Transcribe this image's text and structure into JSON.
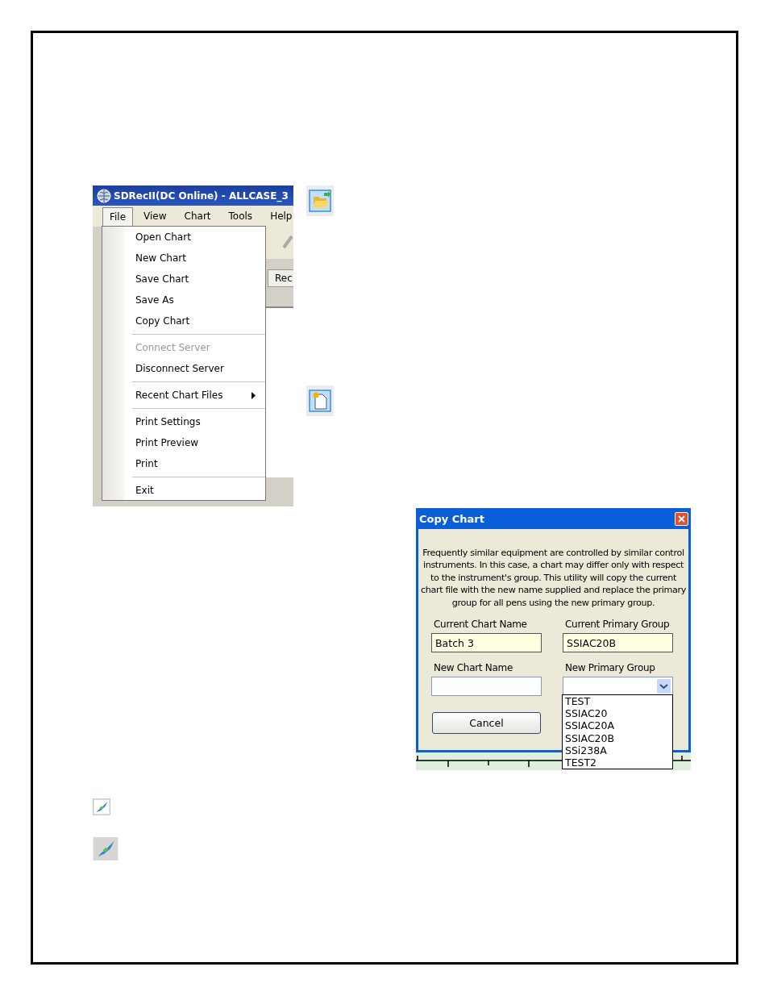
{
  "menu_window": {
    "title": "SDRecII(DC Online) - ALLCASE_3",
    "menu_bar": [
      {
        "label": "File",
        "selected": true
      },
      {
        "label": "View",
        "selected": false
      },
      {
        "label": "Chart",
        "selected": false
      },
      {
        "label": "Tools",
        "selected": false
      },
      {
        "label": "Help",
        "selected": false
      }
    ],
    "background_tab": "Rec",
    "file_menu_groups": [
      [
        {
          "label": "Open Chart",
          "disabled": false,
          "submenu": false
        },
        {
          "label": "New Chart",
          "disabled": false,
          "submenu": false
        },
        {
          "label": "Save Chart",
          "disabled": false,
          "submenu": false
        },
        {
          "label": "Save As",
          "disabled": false,
          "submenu": false
        },
        {
          "label": "Copy Chart",
          "disabled": false,
          "submenu": false
        }
      ],
      [
        {
          "label": "Connect Server",
          "disabled": true,
          "submenu": false
        },
        {
          "label": "Disconnect Server",
          "disabled": false,
          "submenu": false
        }
      ],
      [
        {
          "label": "Recent Chart Files",
          "disabled": false,
          "submenu": true
        }
      ],
      [
        {
          "label": "Print Settings",
          "disabled": false,
          "submenu": false
        },
        {
          "label": "Print Preview",
          "disabled": false,
          "submenu": false
        },
        {
          "label": "Print",
          "disabled": false,
          "submenu": false
        }
      ],
      [
        {
          "label": "Exit",
          "disabled": false,
          "submenu": false
        }
      ]
    ]
  },
  "copy_chart_dialog": {
    "title": "Copy Chart",
    "description": "Frequently similar equipment are controlled by similar control instruments.  In this case, a chart may differ only with respect to the instrument's group.  This utility will copy the current chart file with the new name supplied and replace the primary group for all pens using the new primary group.",
    "current_chart_name": {
      "label": "Current Chart Name",
      "value": "Batch 3"
    },
    "current_primary_group": {
      "label": "Current Primary Group",
      "value": "SSIAC20B"
    },
    "new_chart_name": {
      "label": "New Chart Name"
    },
    "new_primary_group": {
      "label": "New Primary Group",
      "options": [
        "TEST",
        "SSIAC20",
        "SSIAC20A",
        "SSIAC20B",
        "SSi238A",
        "TEST2"
      ]
    },
    "cancel_button": "Cancel"
  }
}
